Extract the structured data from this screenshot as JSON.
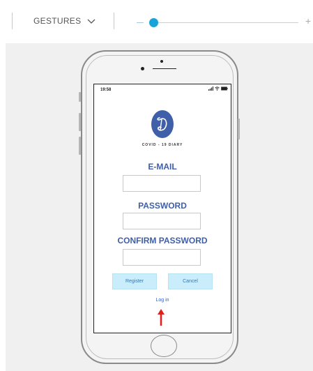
{
  "toolbar": {
    "gestures_label": "GESTURES",
    "slider_min_icon": "minus-icon",
    "slider_max_icon": "plus-icon",
    "slider_value_percent": 5,
    "accent_color": "#1aa3d8"
  },
  "phone": {
    "status_time": "19:58",
    "status_icons": [
      "signal-icon",
      "wifi-icon",
      "battery-icon"
    ],
    "logo_letter": "D",
    "logo_caption": "COVID - 19 DIARY",
    "logo_color": "#3f5fa8",
    "email_label": "E-MAIL",
    "email_value": "",
    "password_label": "PASSWORD",
    "password_value": "",
    "confirm_label": "CONFIRM PASSWORD",
    "confirm_value": "",
    "register_label": "Register",
    "cancel_label": "Cancel",
    "login_label": "Log in",
    "arrow_color": "#e0201c"
  }
}
